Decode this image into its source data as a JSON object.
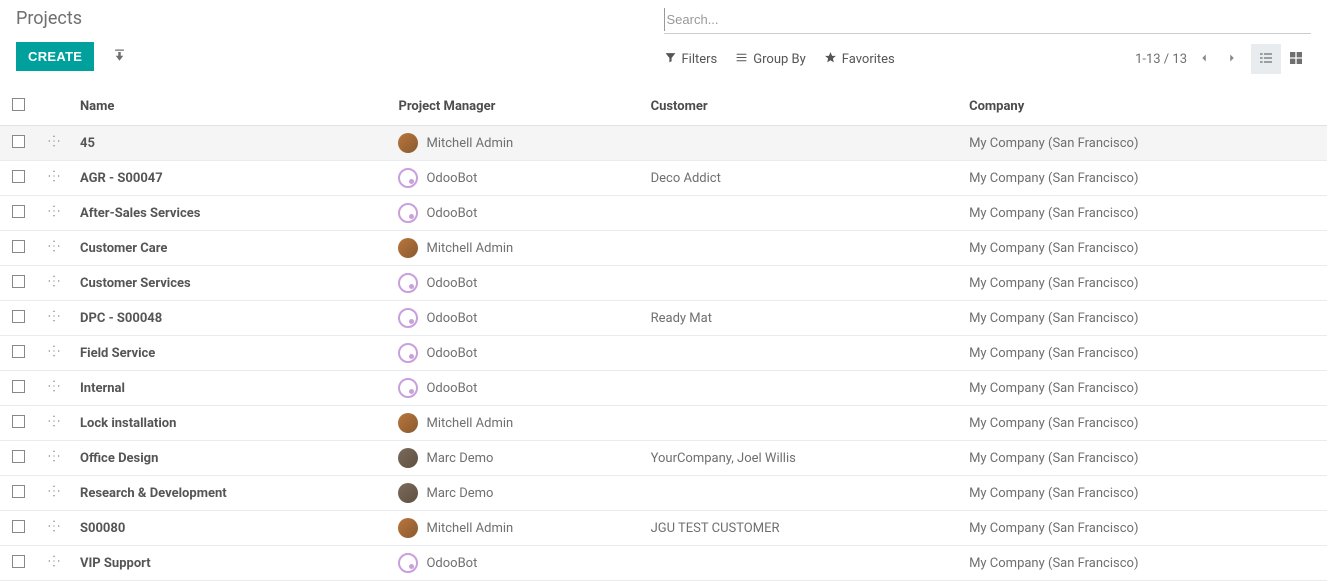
{
  "header": {
    "title": "Projects",
    "create_label": "CREATE"
  },
  "search": {
    "placeholder": "Search..."
  },
  "controls": {
    "filters_label": "Filters",
    "groupby_label": "Group By",
    "favorites_label": "Favorites",
    "pager_text": "1-13 / 13"
  },
  "columns": {
    "name": "Name",
    "pm": "Project Manager",
    "customer": "Customer",
    "company": "Company"
  },
  "rows": [
    {
      "name": "45",
      "pm": "Mitchell Admin",
      "pm_type": "human",
      "customer": "",
      "company": "My Company (San Francisco)",
      "selected": true
    },
    {
      "name": "AGR - S00047",
      "pm": "OdooBot",
      "pm_type": "bot",
      "customer": "Deco Addict",
      "company": "My Company (San Francisco)",
      "selected": false
    },
    {
      "name": "After-Sales Services",
      "pm": "OdooBot",
      "pm_type": "bot",
      "customer": "",
      "company": "My Company (San Francisco)",
      "selected": false
    },
    {
      "name": "Customer Care",
      "pm": "Mitchell Admin",
      "pm_type": "human",
      "customer": "",
      "company": "My Company (San Francisco)",
      "selected": false
    },
    {
      "name": "Customer Services",
      "pm": "OdooBot",
      "pm_type": "bot",
      "customer": "",
      "company": "My Company (San Francisco)",
      "selected": false
    },
    {
      "name": "DPC - S00048",
      "pm": "OdooBot",
      "pm_type": "bot",
      "customer": "Ready Mat",
      "company": "My Company (San Francisco)",
      "selected": false
    },
    {
      "name": "Field Service",
      "pm": "OdooBot",
      "pm_type": "bot",
      "customer": "",
      "company": "My Company (San Francisco)",
      "selected": false
    },
    {
      "name": "Internal",
      "pm": "OdooBot",
      "pm_type": "bot",
      "customer": "",
      "company": "My Company (San Francisco)",
      "selected": false
    },
    {
      "name": "Lock installation",
      "pm": "Mitchell Admin",
      "pm_type": "human",
      "customer": "",
      "company": "My Company (San Francisco)",
      "selected": false
    },
    {
      "name": "Office Design",
      "pm": "Marc Demo",
      "pm_type": "human-alt",
      "customer": "YourCompany, Joel Willis",
      "company": "My Company (San Francisco)",
      "selected": false
    },
    {
      "name": "Research & Development",
      "pm": "Marc Demo",
      "pm_type": "human-alt",
      "customer": "",
      "company": "My Company (San Francisco)",
      "selected": false
    },
    {
      "name": "S00080",
      "pm": "Mitchell Admin",
      "pm_type": "human",
      "customer": "JGU TEST CUSTOMER",
      "company": "My Company (San Francisco)",
      "selected": false
    },
    {
      "name": "VIP Support",
      "pm": "OdooBot",
      "pm_type": "bot",
      "customer": "",
      "company": "My Company (San Francisco)",
      "selected": false
    }
  ]
}
